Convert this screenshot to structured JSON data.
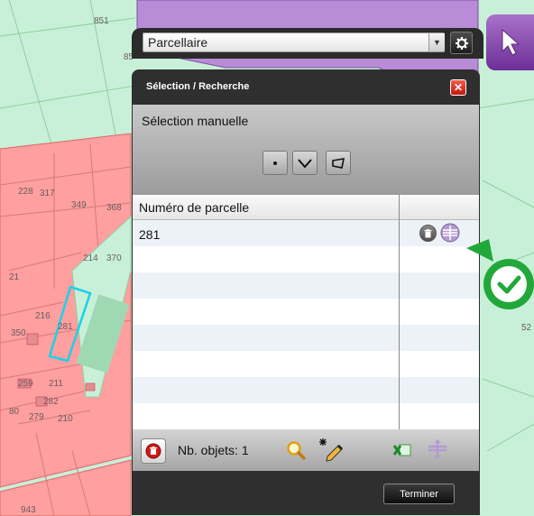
{
  "map": {
    "parcel_labels": [
      "851",
      "85",
      "228",
      "317",
      "349",
      "368",
      "214",
      "370",
      "21",
      "216",
      "281",
      "350",
      "259",
      "211",
      "282",
      "80",
      "279",
      "210",
      "943",
      "52"
    ]
  },
  "layer_selector": {
    "selected": "Parcellaire"
  },
  "panel": {
    "title": "Sélection / Recherche",
    "manual_selection_label": "Sélection manuelle",
    "table": {
      "column_header": "Numéro de parcelle",
      "rows": [
        {
          "parcel_number": "281"
        }
      ]
    },
    "footer": {
      "count_label": "Nb. objets: 1"
    },
    "finish_button": "Terminer"
  },
  "colors": {
    "parcel_fill": "#ff9f9f",
    "zone_fill": "#c8f0d8",
    "purple_zone": "#b98cd8",
    "selected_outline": "#19d2e8",
    "accent_purple": "#8a4bb5",
    "confirm_green": "#22a83a"
  },
  "icons": {
    "settings": "settings-icon",
    "pointer": "pointer-arrow-icon",
    "close": "close-icon",
    "point_tool": "point-select-icon",
    "line_tool": "line-select-icon",
    "polygon_tool": "polygon-select-icon",
    "delete_row": "trash-icon",
    "move_row": "layers-icon",
    "delete_all": "trash-icon",
    "zoom": "magnifier-icon",
    "edit": "magic-pencil-icon",
    "export": "excel-icon",
    "layers": "layers-icon",
    "confirm": "checkmark-icon"
  }
}
